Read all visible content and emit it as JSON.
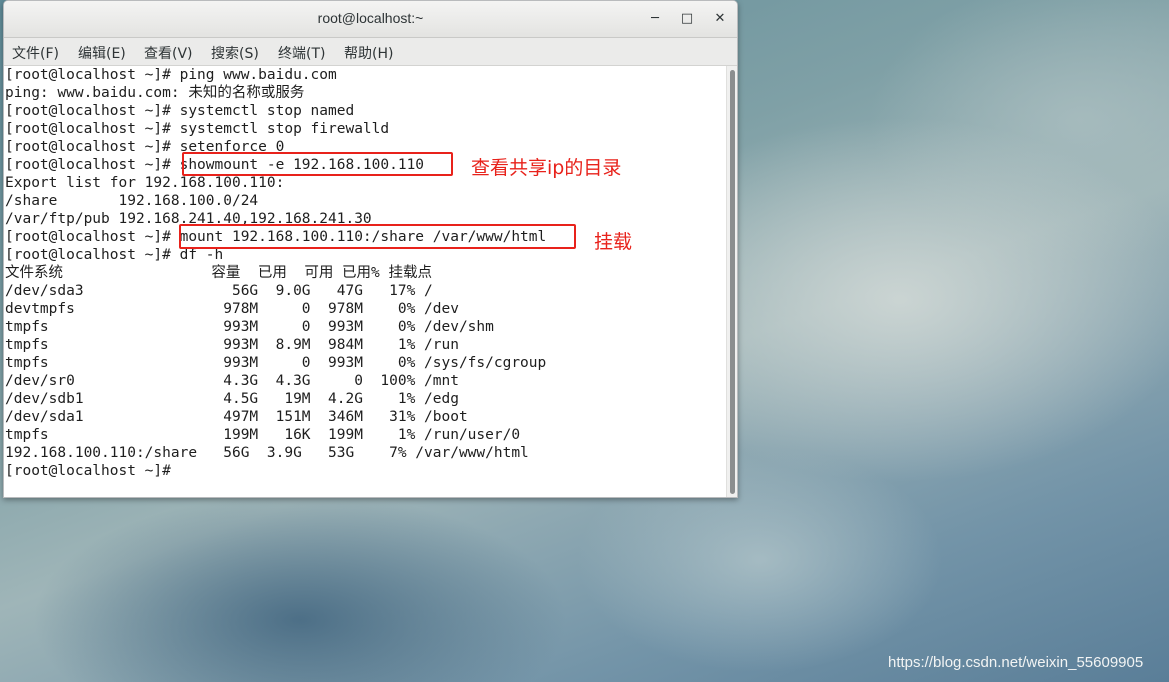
{
  "window": {
    "title": "root@localhost:~",
    "minimize_glyph": "─",
    "maximize_glyph": "□",
    "close_glyph": "✕"
  },
  "menu": {
    "items": [
      "文件(F)",
      "编辑(E)",
      "查看(V)",
      "搜索(S)",
      "终端(T)",
      "帮助(H)"
    ]
  },
  "terminal": {
    "lines": [
      "[root@localhost ~]# ping www.baidu.com",
      "ping: www.baidu.com: 未知的名称或服务",
      "[root@localhost ~]# systemctl stop named",
      "[root@localhost ~]# systemctl stop firewalld",
      "[root@localhost ~]# setenforce 0",
      "[root@localhost ~]# showmount -e 192.168.100.110",
      "Export list for 192.168.100.110:",
      "/share       192.168.100.0/24",
      "/var/ftp/pub 192.168.241.40,192.168.241.30",
      "[root@localhost ~]# mount 192.168.100.110:/share /var/www/html",
      "[root@localhost ~]# df -h",
      "文件系统                 容量  已用  可用 已用% 挂载点",
      "/dev/sda3                 56G  9.0G   47G   17% /",
      "devtmpfs                 978M     0  978M    0% /dev",
      "tmpfs                    993M     0  993M    0% /dev/shm",
      "tmpfs                    993M  8.9M  984M    1% /run",
      "tmpfs                    993M     0  993M    0% /sys/fs/cgroup",
      "/dev/sr0                 4.3G  4.3G     0  100% /mnt",
      "/dev/sdb1                4.5G   19M  4.2G    1% /edg",
      "/dev/sda1                497M  151M  346M   31% /boot",
      "tmpfs                    199M   16K  199M    1% /run/user/0",
      "192.168.100.110:/share   56G  3.9G   53G    7% /var/www/html",
      "[root@localhost ~]#"
    ]
  },
  "annotations": {
    "showmount_note": "查看共享ip的目录",
    "mount_note": "挂载",
    "color": "#e8221b"
  },
  "watermark": "https://blog.csdn.net/weixin_55609905"
}
